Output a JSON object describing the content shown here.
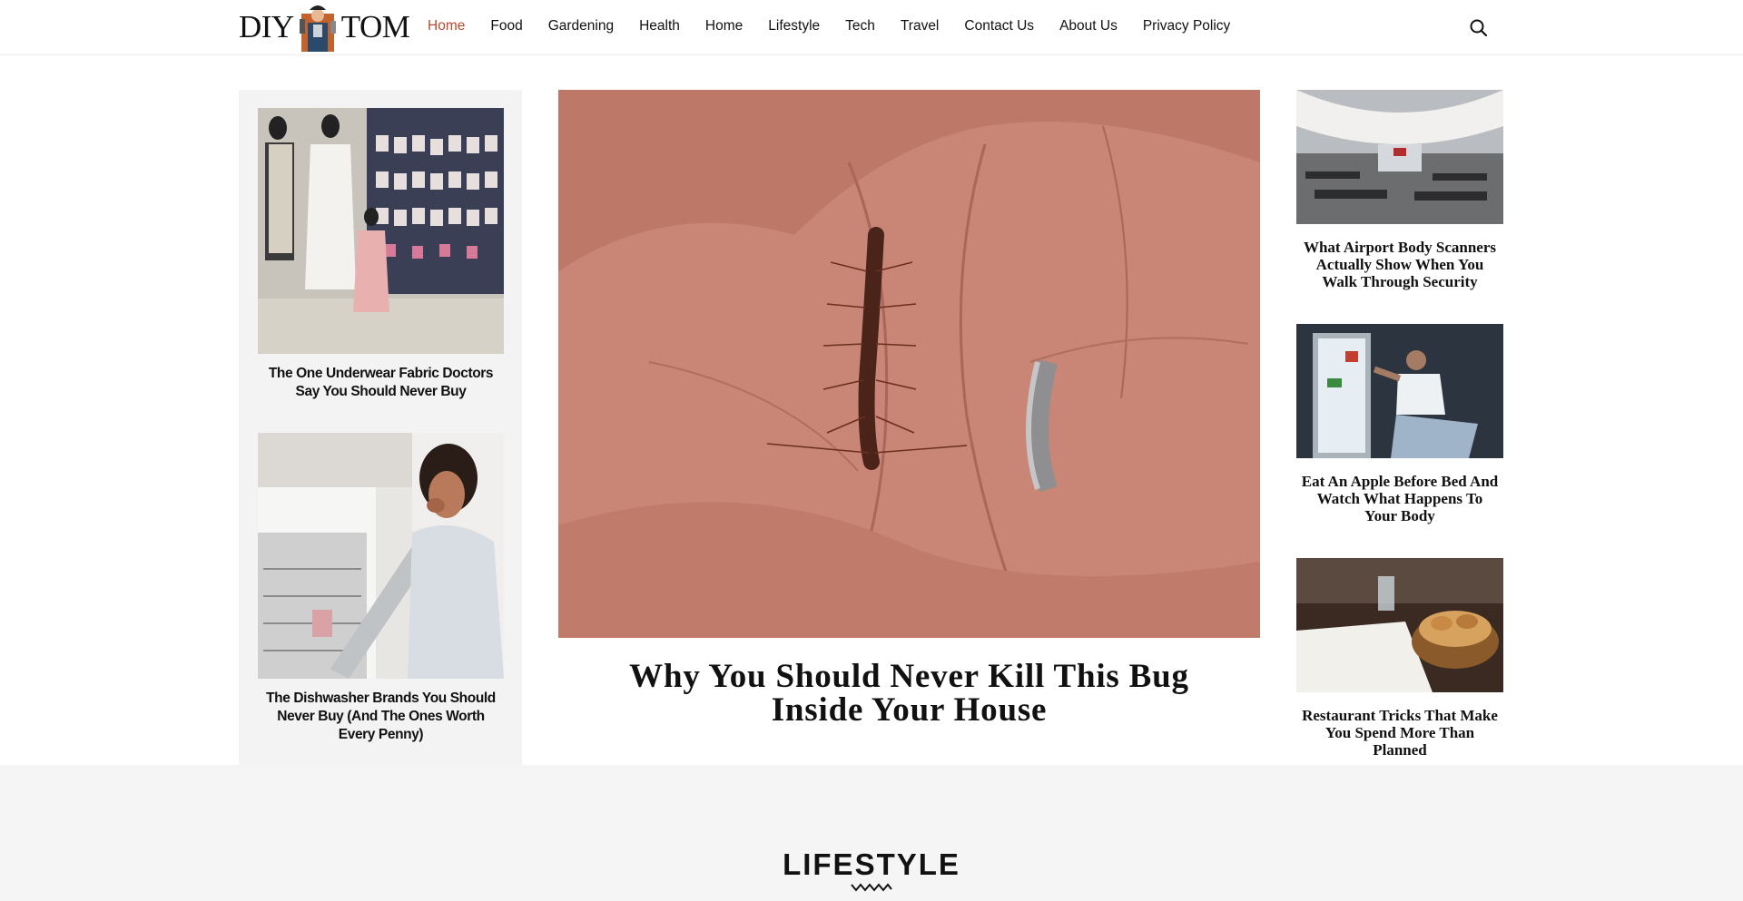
{
  "logo": {
    "left": "DIY",
    "right": "TOM"
  },
  "nav": [
    {
      "label": "Home",
      "active": true
    },
    {
      "label": "Food"
    },
    {
      "label": "Gardening"
    },
    {
      "label": "Health"
    },
    {
      "label": "Home"
    },
    {
      "label": "Lifestyle"
    },
    {
      "label": "Tech"
    },
    {
      "label": "Travel"
    },
    {
      "label": "Contact Us"
    },
    {
      "label": "About Us"
    },
    {
      "label": "Privacy Policy"
    }
  ],
  "search": {
    "icon": "search-icon"
  },
  "left_articles": [
    {
      "title": "The One Underwear Fabric Doctors Say You Should Never Buy"
    },
    {
      "title": "The Dishwasher Brands You Should Never Buy (And The Ones Worth Every Penny)"
    }
  ],
  "hero": {
    "title": "Why You Should Never Kill This Bug Inside Your House"
  },
  "right_articles": [
    {
      "title": "What Airport Body Scanners Actually Show When You Walk Through Security"
    },
    {
      "title": "Eat An Apple Before Bed And Watch What Happens To Your Body"
    },
    {
      "title": "Restaurant Tricks That Make You Spend More Than Planned"
    }
  ],
  "section": {
    "title": "LIFESTYLE"
  },
  "colors": {
    "accent": "#b4492e",
    "panel": "#f3f3f3",
    "section_bg": "#f5f5f5"
  }
}
